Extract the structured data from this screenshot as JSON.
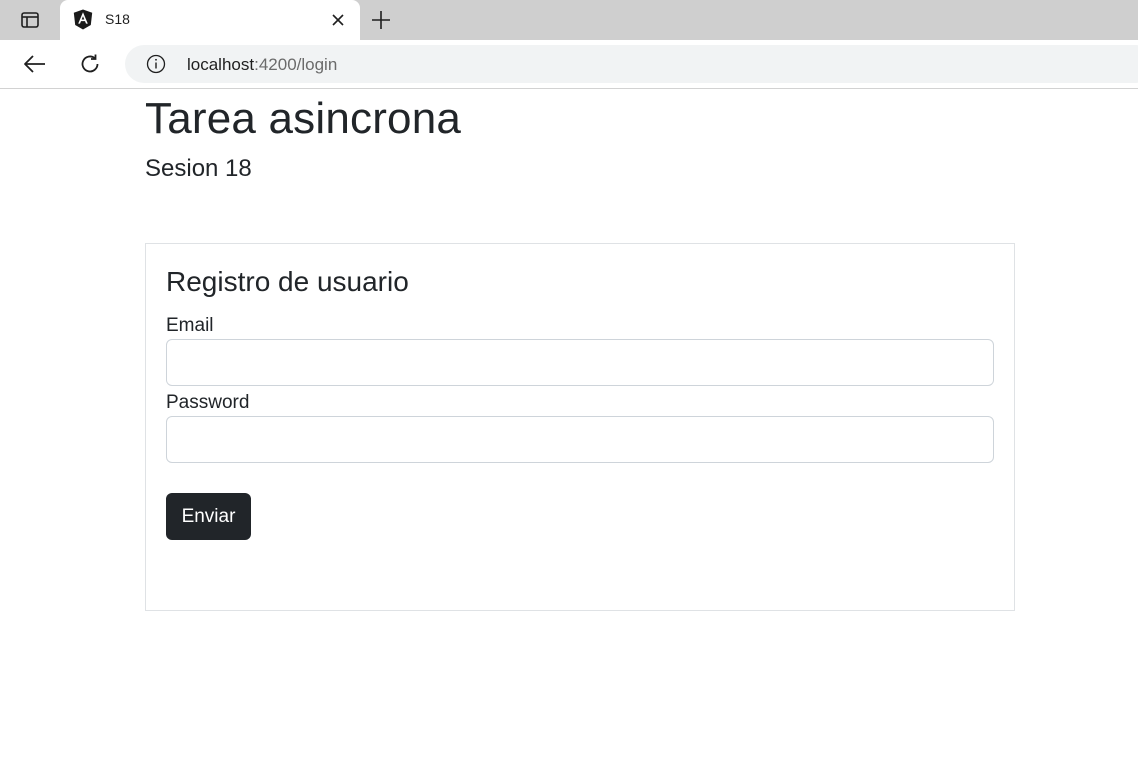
{
  "browser": {
    "tab": {
      "title": "S18",
      "favicon": "angular-logo-icon"
    },
    "tab_actions_icon": "tab-actions-icon",
    "new_tab_icon": "plus-icon",
    "close_tab_icon": "close-icon",
    "back_icon": "arrow-left-icon",
    "reload_icon": "reload-icon",
    "site_info_icon": "info-icon",
    "url": {
      "host": "localhost",
      "rest": ":4200/login"
    }
  },
  "page": {
    "title": "Tarea asincrona",
    "subtitle": "Sesion 18"
  },
  "form": {
    "title": "Registro de usuario",
    "email_label": "Email",
    "email_value": "",
    "password_label": "Password",
    "password_value": "",
    "submit_label": "Enviar"
  },
  "colors": {
    "button_bg": "#212529",
    "text": "#212529",
    "border": "#dfe2e5"
  }
}
